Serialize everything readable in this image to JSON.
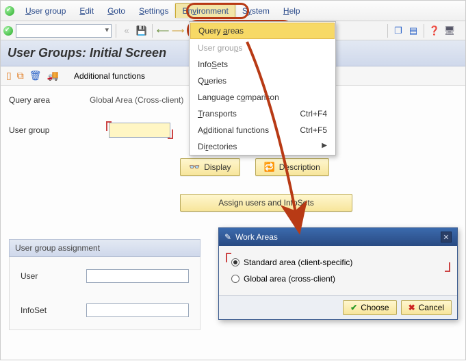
{
  "menubar": {
    "items": [
      {
        "label_pre": "",
        "u": "U",
        "label_post": "ser group"
      },
      {
        "label_pre": "",
        "u": "E",
        "label_post": "dit"
      },
      {
        "label_pre": "",
        "u": "G",
        "label_post": "oto"
      },
      {
        "label_pre": "",
        "u": "S",
        "label_post": "ettings"
      },
      {
        "label_pre": "En",
        "u": "v",
        "label_post": "ironment"
      },
      {
        "label_pre": "S",
        "u": "y",
        "label_post": "stem"
      },
      {
        "label_pre": "",
        "u": "H",
        "label_post": "elp"
      }
    ]
  },
  "dropdown": {
    "items": [
      {
        "pre": "Query ",
        "u": "a",
        "post": "reas",
        "shortcut": "",
        "hl": true
      },
      {
        "pre": "User grou",
        "u": "p",
        "post": "s",
        "shortcut": "",
        "disabled": true
      },
      {
        "pre": "Info",
        "u": "S",
        "post": "ets",
        "shortcut": ""
      },
      {
        "pre": "Q",
        "u": "u",
        "post": "eries",
        "shortcut": ""
      },
      {
        "pre": "Language c",
        "u": "o",
        "post": "mparison",
        "shortcut": ""
      },
      {
        "pre": "",
        "u": "T",
        "post": "ransports",
        "shortcut": "Ctrl+F4"
      },
      {
        "pre": "A",
        "u": "d",
        "post": "ditional functions",
        "shortcut": "Ctrl+F5"
      },
      {
        "pre": "Di",
        "u": "r",
        "post": "ectories",
        "shortcut": "",
        "submenu": true
      }
    ]
  },
  "title": "User Groups: Initial Screen",
  "funcbar": {
    "af_label": "Additional functions"
  },
  "form": {
    "query_area_lbl": "Query area",
    "query_area_val": "Global Area (Cross-client)",
    "user_group_lbl": "User group",
    "user_group_val": ""
  },
  "buttons": {
    "display": "Display",
    "description": "Description",
    "assign": "Assign users and InfoSets"
  },
  "panel": {
    "title": "User group assignment",
    "user_lbl": "User",
    "user_val": "",
    "infoset_lbl": "InfoSet",
    "infoset_val": ""
  },
  "dialog": {
    "title": "Work Areas",
    "opt1": "Standard area (client-specific)",
    "opt2": "Global area (cross-client)",
    "choose": "Choose",
    "cancel": "Cancel"
  }
}
